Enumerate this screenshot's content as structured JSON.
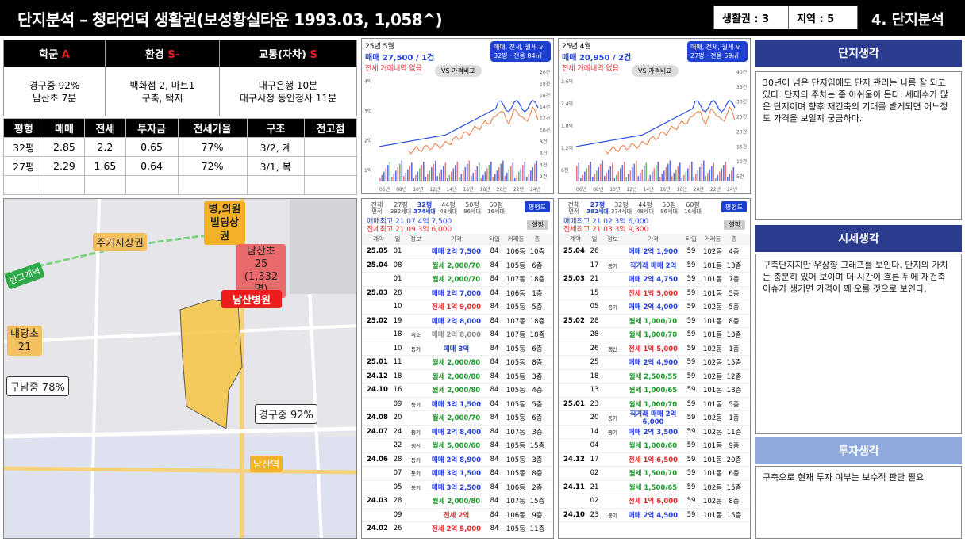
{
  "header": {
    "title": "단지분석 – 청라언덕 생활권(보성황실타운 1993.03, 1,058^)",
    "zone_label": "생활권 : 3",
    "region_label": "지역 : 5",
    "section": "4. 단지분석"
  },
  "grades": [
    {
      "label": "학군",
      "grade": "A",
      "value": "경구중 92%\n남산초 7분"
    },
    {
      "label": "환경",
      "grade": "S-",
      "value": "백화점 2, 마트1\n구축, 택지"
    },
    {
      "label": "교통(자차)",
      "grade": "S",
      "value": "대구은행 10분\n대구시청 동인청사 11분"
    }
  ],
  "price_table": {
    "headers": [
      "평형",
      "매매",
      "전세",
      "투자금",
      "전세가율",
      "구조",
      "전고점"
    ],
    "rows": [
      [
        "32평",
        "2.85",
        "2.2",
        "0.65",
        "77%",
        "3/2, 계",
        ""
      ],
      [
        "27평",
        "2.29",
        "1.65",
        "0.64",
        "72%",
        "3/1, 복",
        ""
      ],
      [
        "",
        "",
        "",
        "",
        "",
        "",
        ""
      ]
    ]
  },
  "map": {
    "labels": {
      "hospital_commercial": "병,의원\n빌딩상권",
      "residential_commercial": "주거지상권",
      "station_bangogae": "반고개역",
      "namsan_elem": "남산초\n25\n(1,332명)",
      "namsan_hospital": "남산병원",
      "naedang_elem": "내당초\n21",
      "gunam_middle": "구남중 78%",
      "gyeonggu_middle": "경구중 92%",
      "namsan_station": "남산역"
    }
  },
  "charts": [
    {
      "date": "25년 5월",
      "price_line": "매매 27,500 / 1건",
      "sub_line": "전세 거래내역 없음",
      "chip_top": "매매, 전세, 월세 ∨",
      "chip_bottom": "32평 · 전용 84㎡",
      "compare": "VS 가격비교",
      "y_left": [
        "4억",
        "3억",
        "2억",
        "1억"
      ],
      "y_right": [
        "20건",
        "18건",
        "16건",
        "14건",
        "12건",
        "10건",
        "8건",
        "6건",
        "4건",
        "2건"
      ],
      "x_labels": [
        "06년",
        "08년",
        "10년",
        "12년",
        "14년",
        "16년",
        "18년",
        "20년",
        "22년",
        "24년"
      ]
    },
    {
      "date": "25년 4월",
      "price_line": "매매 20,950 / 2건",
      "sub_line": "전세 거래내역 없음",
      "chip_top": "매매, 전세, 월세 ∨",
      "chip_bottom": "27평 · 전용 59㎡",
      "compare": "VS 가격비교",
      "y_left": [
        "3.6억",
        "2.4억",
        "1.8억",
        "1.2억",
        "6천"
      ],
      "y_right": [
        "40건",
        "35건",
        "30건",
        "25건",
        "20건",
        "15건",
        "10건",
        "5건"
      ],
      "x_labels": [
        "06년",
        "08년",
        "10년",
        "12년",
        "14년",
        "16년",
        "18년",
        "20년",
        "22년",
        "24년"
      ]
    }
  ],
  "tx_lists": [
    {
      "tabs": [
        "전체",
        "27평",
        "32평",
        "44평",
        "50평",
        "60평"
      ],
      "tab_subs": [
        "면적",
        "382세대",
        "374세대",
        "48세대",
        "86세대",
        "16세대"
      ],
      "button": "평형도",
      "hi1": "매매최고 21.07 4억 7,500",
      "hi2": "전세최고 21.09 3억 6,000",
      "setting": "설정",
      "cols": [
        "계약",
        "일",
        "정보",
        "가격",
        "타입",
        "거래동",
        "층"
      ],
      "rows": [
        [
          "25.05",
          "01",
          "",
          "매매 2억 7,500",
          "84",
          "106동",
          "10층",
          "b"
        ],
        [
          "25.04",
          "08",
          "",
          "월세 2,000/70",
          "84",
          "105동",
          "6층",
          "g"
        ],
        [
          "",
          "01",
          "",
          "월세 2,000/70",
          "84",
          "107동",
          "18층",
          "g"
        ],
        [
          "25.03",
          "28",
          "",
          "매매 2억 7,000",
          "84",
          "106동",
          "1층",
          "b"
        ],
        [
          "",
          "10",
          "",
          "전세 1억 9,000",
          "84",
          "105동",
          "5층",
          "r"
        ],
        [
          "25.02",
          "19",
          "",
          "매매 2억 8,000",
          "84",
          "107동",
          "18층",
          "b"
        ],
        [
          "",
          "18",
          "취소",
          "매매 2억 8,000",
          "84",
          "107동",
          "18층",
          "x"
        ],
        [
          "",
          "10",
          "등기",
          "매매 3억",
          "84",
          "105동",
          "6층",
          "b"
        ],
        [
          "25.01",
          "11",
          "",
          "월세 2,000/80",
          "84",
          "105동",
          "8층",
          "g"
        ],
        [
          "24.12",
          "18",
          "",
          "월세 2,000/80",
          "84",
          "105동",
          "3층",
          "g"
        ],
        [
          "24.10",
          "16",
          "",
          "월세 2,000/80",
          "84",
          "105동",
          "4층",
          "g"
        ],
        [
          "",
          "09",
          "등기",
          "매매 3억 1,500",
          "84",
          "105동",
          "5층",
          "b"
        ],
        [
          "24.08",
          "20",
          "",
          "월세 2,000/70",
          "84",
          "105동",
          "6층",
          "g"
        ],
        [
          "24.07",
          "24",
          "등기",
          "매매 2억 8,400",
          "84",
          "107동",
          "3층",
          "b"
        ],
        [
          "",
          "22",
          "갱신",
          "월세 5,000/60",
          "84",
          "105동",
          "15층",
          "g"
        ],
        [
          "24.06",
          "28",
          "등기",
          "매매 2억 8,900",
          "84",
          "105동",
          "3층",
          "b"
        ],
        [
          "",
          "07",
          "등기",
          "매매 3억 1,500",
          "84",
          "105동",
          "8층",
          "b"
        ],
        [
          "",
          "05",
          "등기",
          "매매 3억 2,500",
          "84",
          "106동",
          "2층",
          "b"
        ],
        [
          "24.03",
          "28",
          "",
          "월세 2,000/80",
          "84",
          "107동",
          "15층",
          "g"
        ],
        [
          "",
          "09",
          "",
          "전세 2억",
          "84",
          "106동",
          "9층",
          "r"
        ],
        [
          "24.02",
          "26",
          "",
          "전세 2억 5,000",
          "84",
          "105동",
          "11층",
          "r"
        ]
      ]
    },
    {
      "tabs": [
        "전체",
        "27평",
        "32평",
        "44평",
        "50평",
        "60평"
      ],
      "tab_subs": [
        "면적",
        "382세대",
        "374세대",
        "48세대",
        "86세대",
        "16세대"
      ],
      "button": "평형도",
      "hi1": "매매최고 21.02 3억 6,000",
      "hi2": "전세최고 21.03 3억 9,300",
      "setting": "설정",
      "cols": [
        "계약",
        "일",
        "정보",
        "가격",
        "타입",
        "거래동",
        "층"
      ],
      "rows": [
        [
          "25.04",
          "26",
          "",
          "매매 2억 1,900",
          "59",
          "102동",
          "4층",
          "b"
        ],
        [
          "",
          "17",
          "등기",
          "직거래 매매 2억",
          "59",
          "101동",
          "13층",
          "b"
        ],
        [
          "25.03",
          "21",
          "",
          "매매 2억 4,750",
          "59",
          "101동",
          "7층",
          "b"
        ],
        [
          "",
          "15",
          "",
          "전세 1억 5,000",
          "59",
          "101동",
          "5층",
          "r"
        ],
        [
          "",
          "05",
          "등기",
          "매매 2억 4,000",
          "59",
          "102동",
          "5층",
          "b"
        ],
        [
          "25.02",
          "28",
          "",
          "월세 1,000/70",
          "59",
          "101동",
          "8층",
          "g"
        ],
        [
          "",
          "28",
          "",
          "월세 1,000/70",
          "59",
          "101동",
          "13층",
          "g"
        ],
        [
          "",
          "26",
          "갱신",
          "전세 1억 5,000",
          "59",
          "102동",
          "1층",
          "r"
        ],
        [
          "",
          "25",
          "",
          "매매 2억 4,900",
          "59",
          "102동",
          "15층",
          "b"
        ],
        [
          "",
          "18",
          "",
          "월세 2,500/55",
          "59",
          "102동",
          "12층",
          "g"
        ],
        [
          "",
          "13",
          "",
          "월세 1,000/65",
          "59",
          "101동",
          "18층",
          "g"
        ],
        [
          "25.01",
          "23",
          "",
          "월세 1,000/70",
          "59",
          "101동",
          "5층",
          "g"
        ],
        [
          "",
          "20",
          "등기",
          "직거래 매매 2억 6,000",
          "59",
          "102동",
          "1층",
          "b"
        ],
        [
          "",
          "14",
          "등기",
          "매매 2억 3,500",
          "59",
          "102동",
          "11층",
          "b"
        ],
        [
          "",
          "04",
          "",
          "월세 1,000/60",
          "59",
          "101동",
          "9층",
          "g"
        ],
        [
          "24.12",
          "17",
          "",
          "전세 1억 6,500",
          "59",
          "101동",
          "20층",
          "r"
        ],
        [
          "",
          "02",
          "",
          "월세 1,500/70",
          "59",
          "101동",
          "6층",
          "g"
        ],
        [
          "24.11",
          "21",
          "",
          "월세 1,500/65",
          "59",
          "102동",
          "15층",
          "g"
        ],
        [
          "",
          "02",
          "",
          "전세 1억 6,000",
          "59",
          "102동",
          "8층",
          "r"
        ],
        [
          "24.10",
          "23",
          "등기",
          "매매 2억 4,500",
          "59",
          "101동",
          "15층",
          "b"
        ]
      ]
    }
  ],
  "right": {
    "t1": "단지생각",
    "n1": "30년이 넘은 단지임에도 단지 관리는 나름 잘 되고 있다. 단지의 주차는 좀 아쉬움이 든다. 세대수가 많은 단지이며 향후 재건축의 기대를 받게되면 어느정도 가격을 보일지 궁금하다.",
    "t2": "시세생각",
    "n2": "구축단지지만 우상향 그래프를 보인다. 단지의 가치는 충분히 있어 보이며 더 시간이 흐른 뒤에 재건축 이슈가 생기면 가격이 꽤 오를 것으로 보인다.",
    "t3": "투자생각",
    "n3": "구축으로 현재 투자 여부는 보수적 판단 필요"
  }
}
